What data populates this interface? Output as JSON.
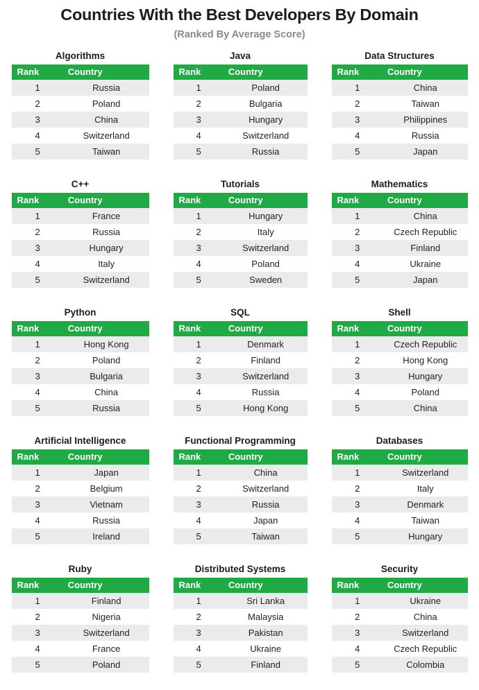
{
  "header": {
    "title": "Countries With the Best Developers By Domain",
    "subtitle": "(Ranked By Average Score)"
  },
  "colors": {
    "header_green": "#1faa46",
    "row_shaded": "#ebebeb",
    "row_plain": "#ffffff",
    "title_color": "#1c1c1c",
    "subtitle_color": "#8a8a8a"
  },
  "columns": {
    "rank": "Rank",
    "country": "Country"
  },
  "chart_data": {
    "type": "table",
    "title": "Countries With the Best Developers By Domain",
    "subtitle": "(Ranked By Average Score)",
    "columns": [
      "Rank",
      "Country"
    ],
    "tables": [
      {
        "domain": "Algorithms",
        "rows": [
          {
            "rank": "1",
            "country": "Russia"
          },
          {
            "rank": "2",
            "country": "Poland"
          },
          {
            "rank": "3",
            "country": "China"
          },
          {
            "rank": "4",
            "country": "Switzerland"
          },
          {
            "rank": "5",
            "country": "Taiwan"
          }
        ]
      },
      {
        "domain": "Java",
        "rows": [
          {
            "rank": "1",
            "country": "Poland"
          },
          {
            "rank": "2",
            "country": "Bulgaria"
          },
          {
            "rank": "3",
            "country": "Hungary"
          },
          {
            "rank": "4",
            "country": "Switzerland"
          },
          {
            "rank": "5",
            "country": "Russia"
          }
        ]
      },
      {
        "domain": "Data Structures",
        "rows": [
          {
            "rank": "1",
            "country": "China"
          },
          {
            "rank": "2",
            "country": "Taiwan"
          },
          {
            "rank": "3",
            "country": "Philippines"
          },
          {
            "rank": "4",
            "country": "Russia"
          },
          {
            "rank": "5",
            "country": "Japan"
          }
        ]
      },
      {
        "domain": "C++",
        "rows": [
          {
            "rank": "1",
            "country": "France"
          },
          {
            "rank": "2",
            "country": "Russia"
          },
          {
            "rank": "3",
            "country": "Hungary"
          },
          {
            "rank": "4",
            "country": "Italy"
          },
          {
            "rank": "5",
            "country": "Switzerland"
          }
        ]
      },
      {
        "domain": "Tutorials",
        "rows": [
          {
            "rank": "1",
            "country": "Hungary"
          },
          {
            "rank": "2",
            "country": "Italy"
          },
          {
            "rank": "3",
            "country": "Switzerland"
          },
          {
            "rank": "4",
            "country": "Poland"
          },
          {
            "rank": "5",
            "country": "Sweden"
          }
        ]
      },
      {
        "domain": "Mathematics",
        "rows": [
          {
            "rank": "1",
            "country": "China"
          },
          {
            "rank": "2",
            "country": "Czech Republic"
          },
          {
            "rank": "3",
            "country": "Finland"
          },
          {
            "rank": "4",
            "country": "Ukraine"
          },
          {
            "rank": "5",
            "country": "Japan"
          }
        ]
      },
      {
        "domain": "Python",
        "rows": [
          {
            "rank": "1",
            "country": "Hong Kong"
          },
          {
            "rank": "2",
            "country": "Poland"
          },
          {
            "rank": "3",
            "country": "Bulgaria"
          },
          {
            "rank": "4",
            "country": "China"
          },
          {
            "rank": "5",
            "country": "Russia"
          }
        ]
      },
      {
        "domain": "SQL",
        "rows": [
          {
            "rank": "1",
            "country": "Denmark"
          },
          {
            "rank": "2",
            "country": "Finland"
          },
          {
            "rank": "3",
            "country": "Switzerland"
          },
          {
            "rank": "4",
            "country": "Russia"
          },
          {
            "rank": "5",
            "country": "Hong Kong"
          }
        ]
      },
      {
        "domain": "Shell",
        "rows": [
          {
            "rank": "1",
            "country": "Czech Republic"
          },
          {
            "rank": "2",
            "country": "Hong Kong"
          },
          {
            "rank": "3",
            "country": "Hungary"
          },
          {
            "rank": "4",
            "country": "Poland"
          },
          {
            "rank": "5",
            "country": "China"
          }
        ]
      },
      {
        "domain": "Artificial Intelligence",
        "rows": [
          {
            "rank": "1",
            "country": "Japan"
          },
          {
            "rank": "2",
            "country": "Belgium"
          },
          {
            "rank": "3",
            "country": "Vietnam"
          },
          {
            "rank": "4",
            "country": "Russia"
          },
          {
            "rank": "5",
            "country": "Ireland"
          }
        ]
      },
      {
        "domain": "Functional Programming",
        "rows": [
          {
            "rank": "1",
            "country": "China"
          },
          {
            "rank": "2",
            "country": "Switzerland"
          },
          {
            "rank": "3",
            "country": "Russia"
          },
          {
            "rank": "4",
            "country": "Japan"
          },
          {
            "rank": "5",
            "country": "Taiwan"
          }
        ]
      },
      {
        "domain": "Databases",
        "rows": [
          {
            "rank": "1",
            "country": "Switzerland"
          },
          {
            "rank": "2",
            "country": "Italy"
          },
          {
            "rank": "3",
            "country": "Denmark"
          },
          {
            "rank": "4",
            "country": "Taiwan"
          },
          {
            "rank": "5",
            "country": "Hungary"
          }
        ]
      },
      {
        "domain": "Ruby",
        "rows": [
          {
            "rank": "1",
            "country": "Finland"
          },
          {
            "rank": "2",
            "country": "Nigeria"
          },
          {
            "rank": "3",
            "country": "Switzerland"
          },
          {
            "rank": "4",
            "country": "France"
          },
          {
            "rank": "5",
            "country": "Poland"
          }
        ]
      },
      {
        "domain": "Distributed Systems",
        "rows": [
          {
            "rank": "1",
            "country": "Sri Lanka"
          },
          {
            "rank": "2",
            "country": "Malaysia"
          },
          {
            "rank": "3",
            "country": "Pakistan"
          },
          {
            "rank": "4",
            "country": "Ukraine"
          },
          {
            "rank": "5",
            "country": "Finland"
          }
        ]
      },
      {
        "domain": "Security",
        "rows": [
          {
            "rank": "1",
            "country": "Ukraine"
          },
          {
            "rank": "2",
            "country": "China"
          },
          {
            "rank": "3",
            "country": "Switzerland"
          },
          {
            "rank": "4",
            "country": "Czech Republic"
          },
          {
            "rank": "5",
            "country": "Colombia"
          }
        ]
      }
    ]
  }
}
